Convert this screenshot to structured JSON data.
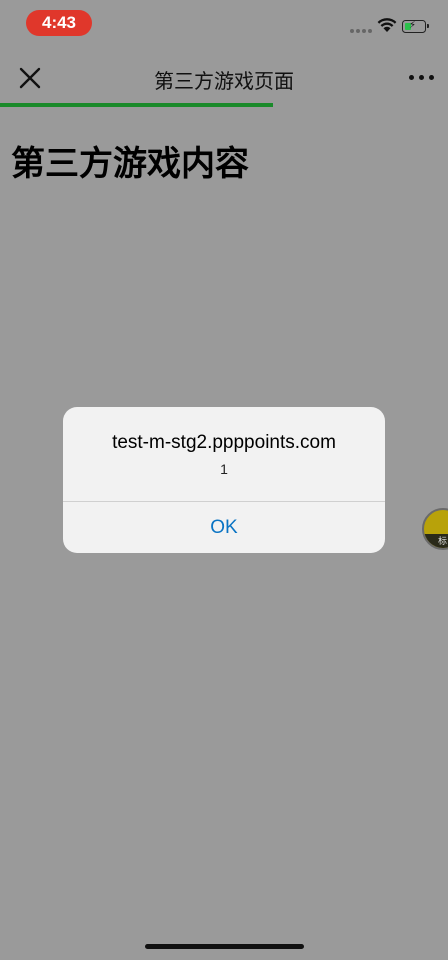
{
  "status_bar": {
    "time": "4:43",
    "battery_charge_fraction": 0.35
  },
  "nav": {
    "title": "第三方游戏页面",
    "close_icon": "close-icon",
    "more_icon": "more-dots-icon",
    "load_progress_fraction": 0.61,
    "accent_color": "#1a8a2a"
  },
  "content": {
    "heading": "第三方游戏内容"
  },
  "alert": {
    "title": "test-m-stg2.ppppoints.com",
    "message": "1",
    "ok_label": "OK",
    "ok_color": "#0a74c4"
  },
  "floating_badge": {
    "glyph": "标"
  }
}
